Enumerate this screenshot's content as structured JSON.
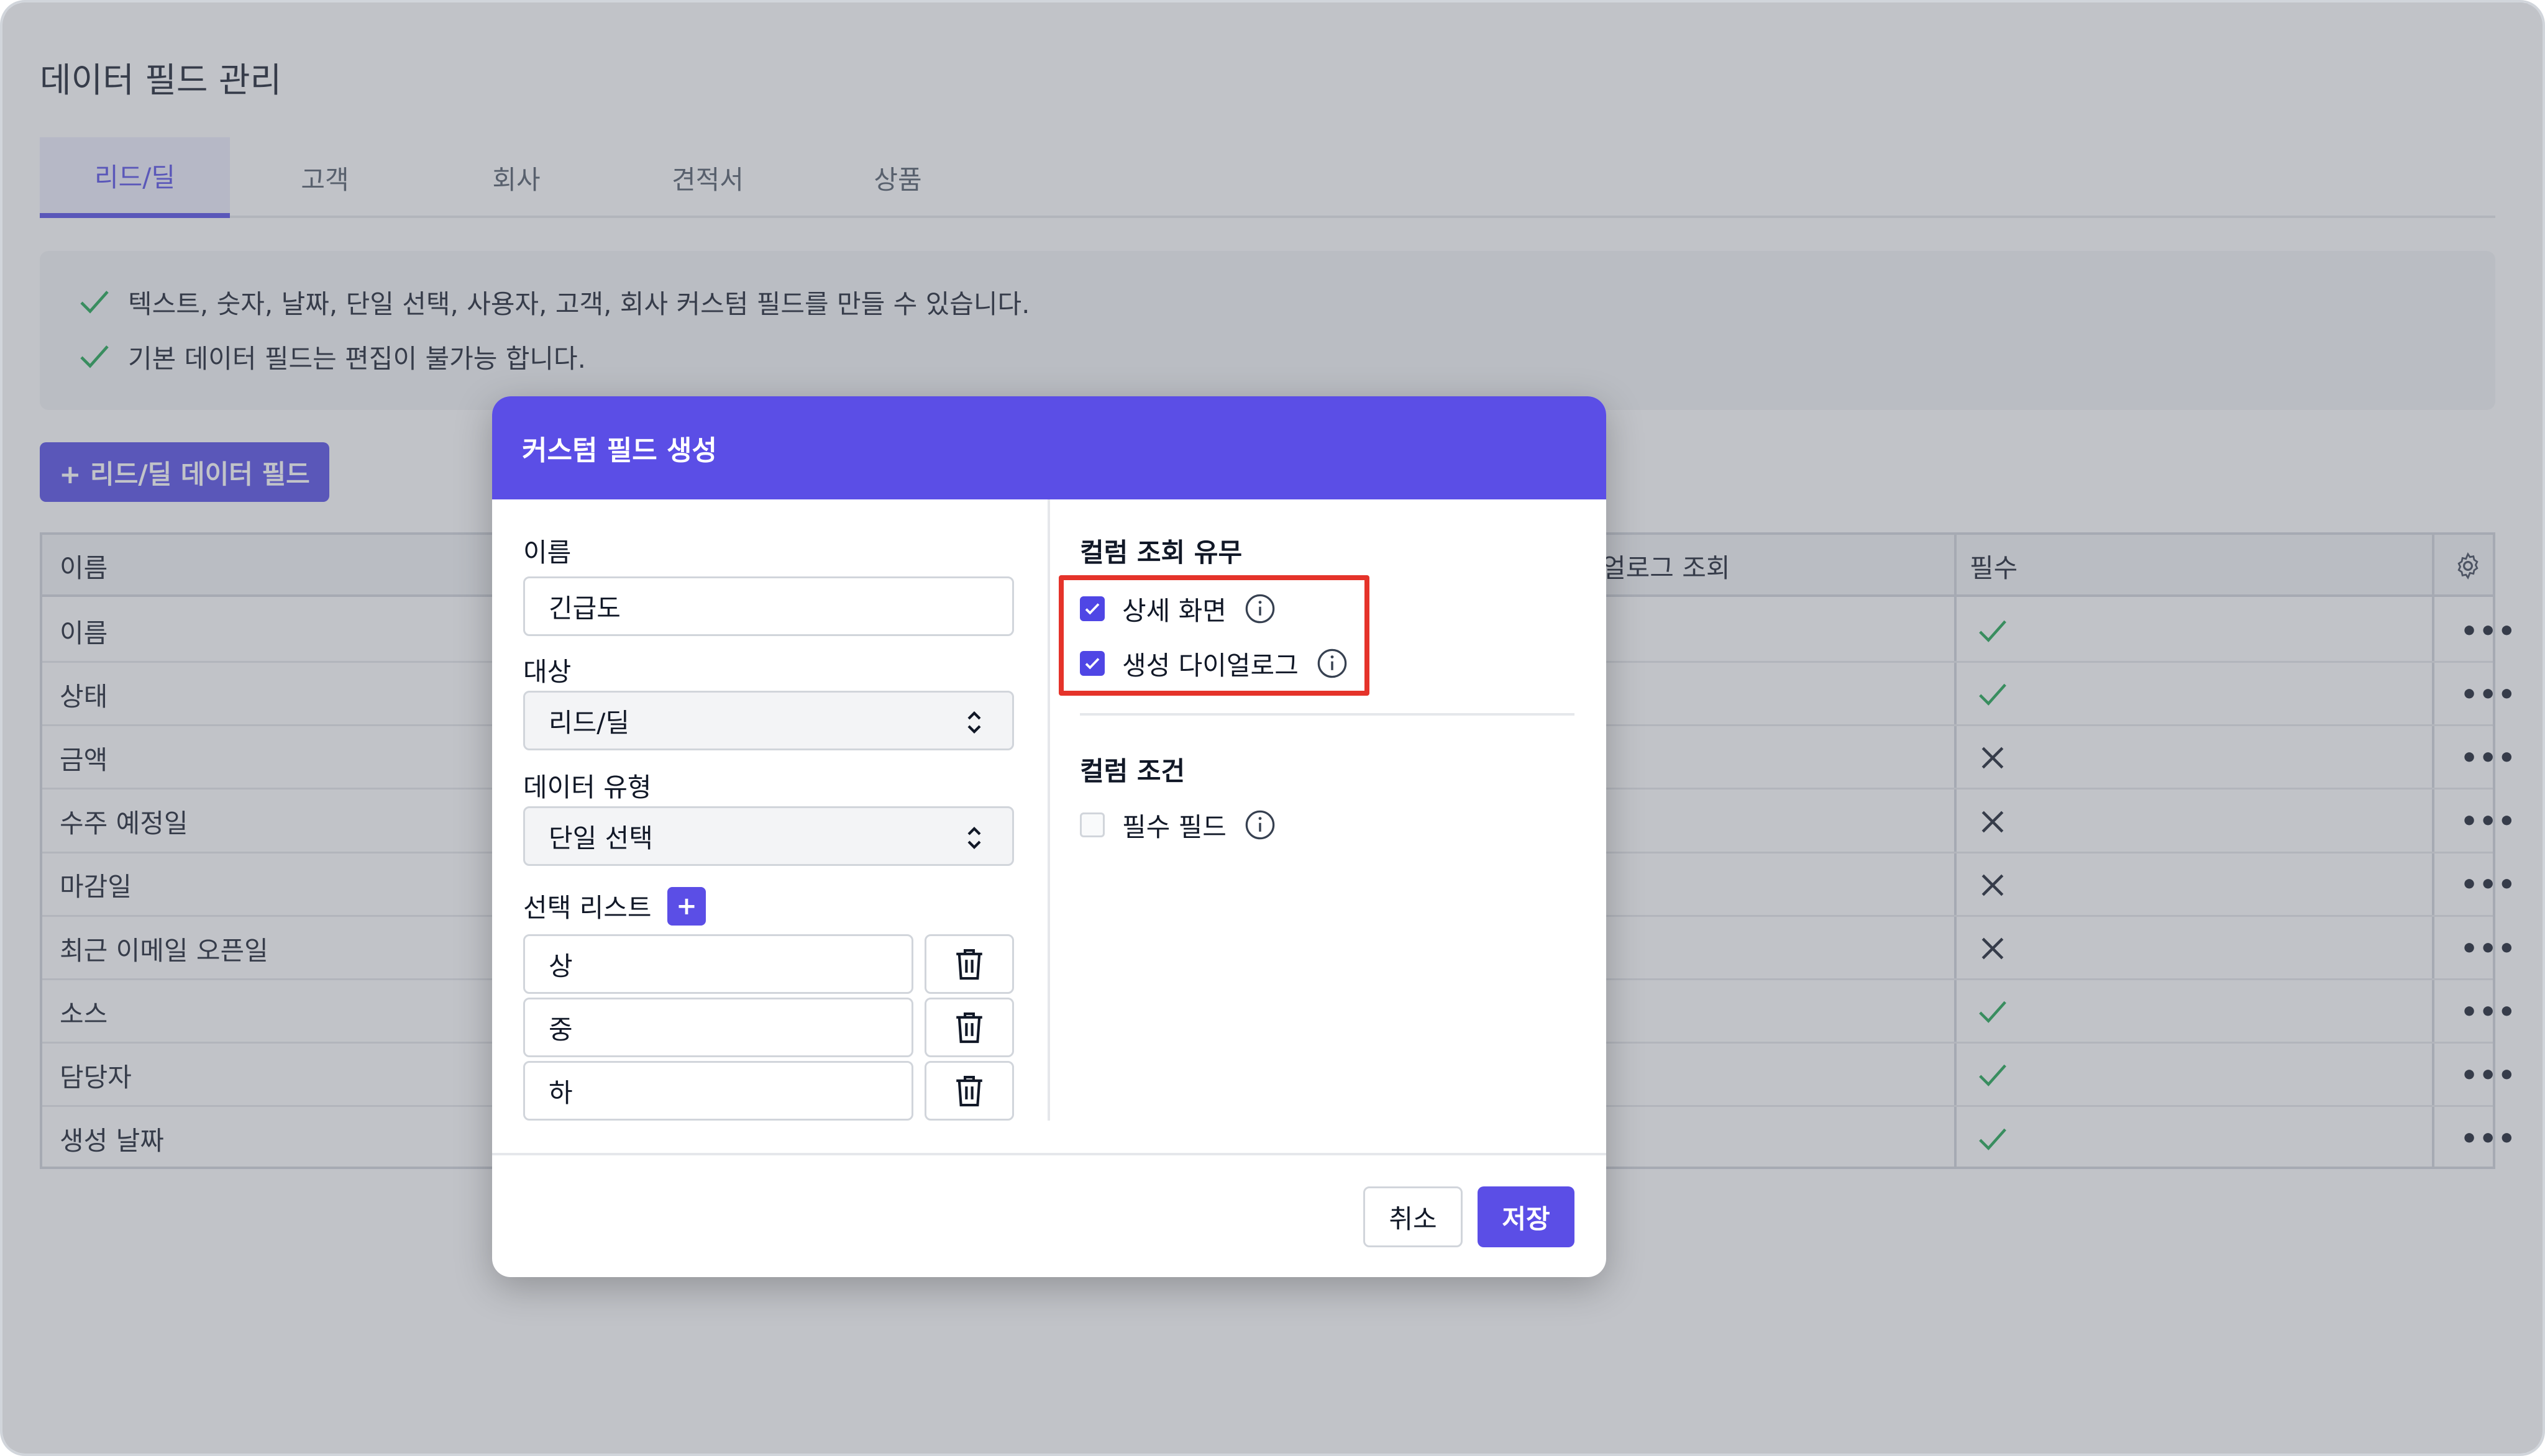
{
  "page": {
    "title": "데이터 필드 관리",
    "tabs": [
      {
        "label": "리드/딜",
        "active": true
      },
      {
        "label": "고객",
        "active": false
      },
      {
        "label": "회사",
        "active": false
      },
      {
        "label": "견적서",
        "active": false
      },
      {
        "label": "상품",
        "active": false
      }
    ],
    "info_lines": [
      "텍스트, 숫자, 날짜, 단일 선택, 사용자, 고객, 회사 커스텀 필드를 만들 수 있습니다.",
      "기본 데이터 필드는 편집이 불가능 합니다."
    ],
    "add_button": "+ 리드/딜 데이터 필드",
    "colors": {
      "accent": "#4f46e5",
      "check": "#16a34a",
      "highlight": "#e5332a"
    }
  },
  "table": {
    "headers": {
      "name": "이름",
      "dialog_view": "얼로그 조회",
      "required": "필수",
      "settings_icon": "gear-icon"
    },
    "rows": [
      {
        "name": "이름",
        "required": "check",
        "more": "•••"
      },
      {
        "name": "상태",
        "required": "check",
        "more": "•••"
      },
      {
        "name": "금액",
        "required": "x",
        "more": "•••"
      },
      {
        "name": "수주 예정일",
        "required": "x",
        "more": "•••"
      },
      {
        "name": "마감일",
        "required": "x",
        "more": "•••"
      },
      {
        "name": "최근 이메일 오픈일",
        "required": "x",
        "more": "•••"
      },
      {
        "name": "소스",
        "required": "check",
        "more": "•••"
      },
      {
        "name": "담당자",
        "required": "check",
        "more": "•••"
      },
      {
        "name": "생성 날짜",
        "required": "check",
        "more": "•••"
      }
    ]
  },
  "modal": {
    "title": "커스텀 필드 생성",
    "name_label": "이름",
    "name_value": "긴급도",
    "target_label": "대상",
    "target_value": "리드/딜",
    "type_label": "데이터 유형",
    "type_value": "단일 선택",
    "list_label": "선택 리스트",
    "list_add": "+",
    "options": [
      "상",
      "중",
      "하"
    ],
    "view_section": "컬럼 조회 유무",
    "view_detail": {
      "label": "상세 화면",
      "checked": true
    },
    "view_create": {
      "label": "생성 다이얼로그",
      "checked": true
    },
    "cond_section": "컬럼 조건",
    "cond_required": {
      "label": "필수 필드",
      "checked": false
    },
    "cancel": "취소",
    "save": "저장"
  }
}
